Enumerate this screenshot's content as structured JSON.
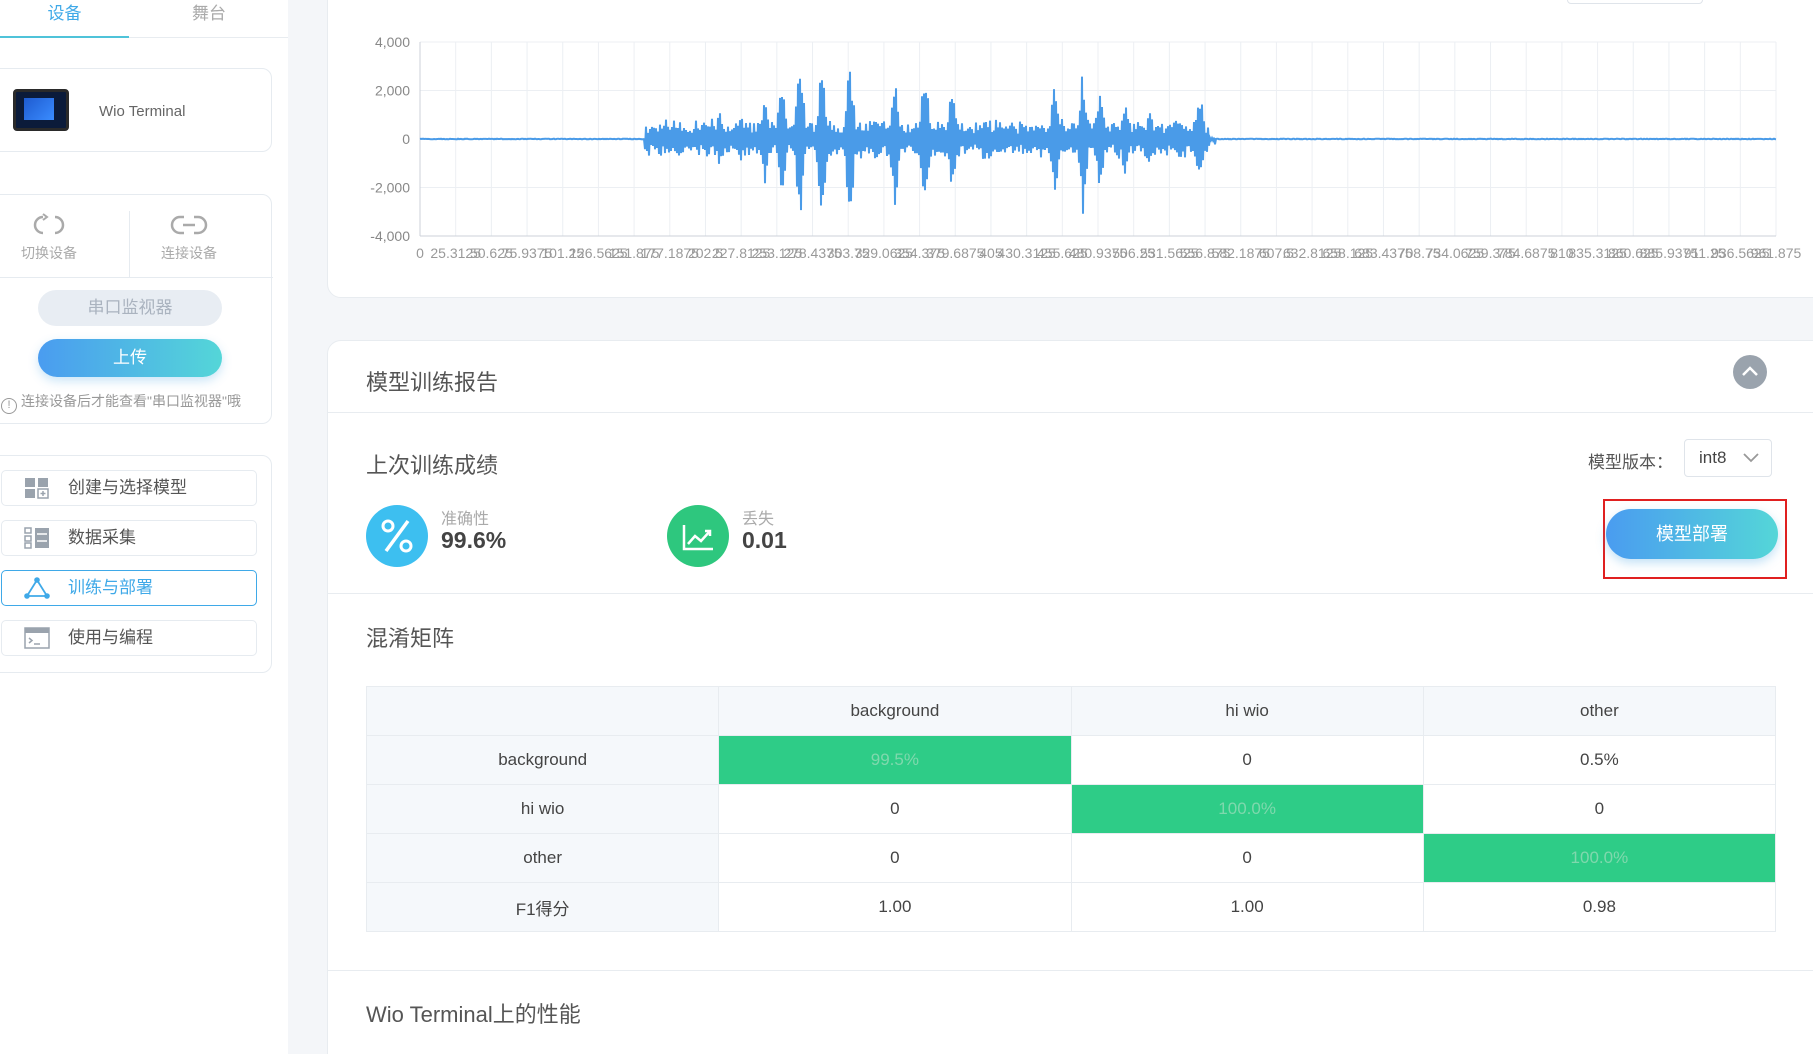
{
  "sidebar": {
    "tabs": {
      "device": "设备",
      "stage": "舞台"
    },
    "device_name": "Wio Terminal",
    "actions": {
      "switch_device": "切换设备",
      "connect_device": "连接设备"
    },
    "serial_monitor": "串口监视器",
    "upload": "上传",
    "hint": "连接设备后才能查看\"串口监视器\"哦",
    "menu": [
      {
        "label": "创建与选择模型",
        "icon": "grid-plus-icon"
      },
      {
        "label": "数据采集",
        "icon": "data-list-icon"
      },
      {
        "label": "训练与部署",
        "icon": "network-triangle-icon"
      },
      {
        "label": "使用与编程",
        "icon": "terminal-window-icon"
      }
    ]
  },
  "colors": {
    "accent": "#3fa9e8",
    "gradient_start": "#4a9cf0",
    "gradient_end": "#54d6d8",
    "matrix_highlight": "#2ecc87",
    "waveform": "#4a9be8",
    "highlight_box": "#e02020"
  },
  "chart_data": {
    "type": "line",
    "y_ticks": [
      "4,000",
      "2,000",
      "0",
      "-2,000",
      "-4,000"
    ],
    "ylim": [
      -4000,
      4000
    ],
    "x_tick_labels": [
      "0",
      "25.3125",
      "50.625",
      "75.9375",
      "101.25",
      "126.5625",
      "151.875",
      "177.1875",
      "202.5",
      "227.8125",
      "253.125",
      "278.4375",
      "303.75",
      "329.0625",
      "354.375",
      "379.6875",
      "405",
      "430.3125",
      "455.625",
      "480.9375",
      "506.25",
      "531.5625",
      "556.875",
      "582.1875",
      "607.5",
      "632.8125",
      "658.125",
      "683.4375",
      "708.75",
      "734.0625",
      "759.375",
      "784.6875",
      "810",
      "835.3125",
      "860.625",
      "885.9375",
      "911.25",
      "936.5625",
      "961.875"
    ],
    "grid": true,
    "legend": "none"
  },
  "report": {
    "title": "模型训练报告",
    "last_training": "上次训练成绩",
    "accuracy_label": "准确性",
    "accuracy_value": "99.6%",
    "loss_label": "丢失",
    "loss_value": "0.01",
    "version_label": "模型版本：",
    "version_value": "int8",
    "deploy_button": "模型部署",
    "confusion_title": "混淆矩阵",
    "confusion": {
      "columns": [
        "background",
        "hi wio",
        "other"
      ],
      "rows": [
        {
          "label": "background",
          "cells": [
            "99.5%",
            "0",
            "0.5%"
          ]
        },
        {
          "label": "hi wio",
          "cells": [
            "0",
            "100.0%",
            "0"
          ]
        },
        {
          "label": "other",
          "cells": [
            "0",
            "0",
            "100.0%"
          ]
        },
        {
          "label": "F1得分",
          "cells": [
            "1.00",
            "1.00",
            "0.98"
          ]
        }
      ]
    },
    "performance_title": "Wio Terminal上的性能"
  }
}
